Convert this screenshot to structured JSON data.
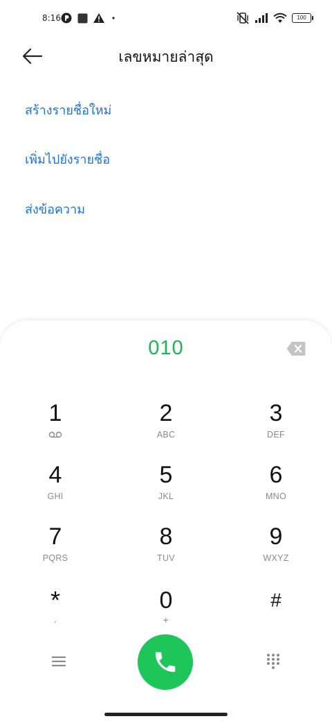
{
  "status_bar": {
    "time": "8:16",
    "battery": "100"
  },
  "header": {
    "title": "เลขหมายล่าสุด"
  },
  "actions": [
    {
      "label": "สร้างรายชื่อใหม่"
    },
    {
      "label": "เพิ่มไปยังรายชื่อ"
    },
    {
      "label": "ส่งข้อความ"
    }
  ],
  "dialer": {
    "number": "010",
    "keys": [
      {
        "digit": "1",
        "letters": ""
      },
      {
        "digit": "2",
        "letters": "ABC"
      },
      {
        "digit": "3",
        "letters": "DEF"
      },
      {
        "digit": "4",
        "letters": "GHI"
      },
      {
        "digit": "5",
        "letters": "JKL"
      },
      {
        "digit": "6",
        "letters": "MNO"
      },
      {
        "digit": "7",
        "letters": "PQRS"
      },
      {
        "digit": "8",
        "letters": "TUV"
      },
      {
        "digit": "9",
        "letters": "WXYZ"
      },
      {
        "digit": "*",
        "letters": ","
      },
      {
        "digit": "0",
        "letters": "+"
      },
      {
        "digit": "#",
        "letters": ""
      }
    ]
  },
  "colors": {
    "accent_blue": "#1a73d9",
    "call_green": "#1ec65a",
    "number_green": "#1fb353"
  },
  "icons": {
    "back": "arrow-left-icon",
    "backspace": "backspace-icon",
    "voicemail": "voicemail-icon",
    "menu": "menu-icon",
    "call": "phone-icon",
    "keypad": "dialpad-icon"
  }
}
